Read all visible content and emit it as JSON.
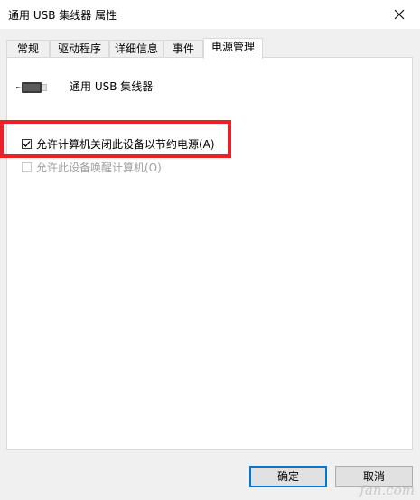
{
  "window": {
    "title": "通用 USB 集线器 属性",
    "close_icon": "close-icon"
  },
  "tabs": [
    {
      "label": "常规"
    },
    {
      "label": "驱动程序"
    },
    {
      "label": "详细信息"
    },
    {
      "label": "事件"
    },
    {
      "label": "电源管理",
      "active": true
    }
  ],
  "device": {
    "name": "通用 USB 集线器",
    "icon": "usb-connector-icon"
  },
  "options": {
    "allow_power_off": {
      "label": "允许计算机关闭此设备以节约电源(A)",
      "checked": true
    },
    "allow_wake": {
      "label": "允许此设备唤醒计算机(O)",
      "checked": false,
      "disabled": true
    }
  },
  "buttons": {
    "ok": "确定",
    "cancel": "取消"
  },
  "watermark": "fan.com",
  "colors": {
    "highlight": "#e8202a",
    "accent": "#0078d7"
  }
}
